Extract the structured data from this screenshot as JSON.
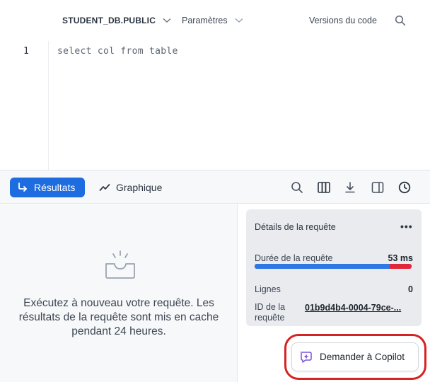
{
  "toolbar": {
    "database": "STUDENT_DB.PUBLIC",
    "params_label": "Paramètres",
    "versions_label": "Versions du code"
  },
  "editor": {
    "line_number": "1",
    "code": "select col from table"
  },
  "results_bar": {
    "results_label": "Résultats",
    "chart_label": "Graphique"
  },
  "empty_state": {
    "message": "Exécutez à nouveau votre requête. Les résultats de la requête sont mis en cache pendant 24 heures."
  },
  "details": {
    "title": "Détails de la requête",
    "more": "•••",
    "duration_label": "Durée de la requête",
    "duration_value": "53 ms",
    "duration_split": 0.86,
    "rows_label": "Lignes",
    "rows_value": "0",
    "id_label": "ID de la requête",
    "id_value": "01b9d4b4-0004-79ce-..."
  },
  "copilot": {
    "label": "Demander à Copilot"
  },
  "colors": {
    "accent": "#1d6ce0",
    "bar_blue": "#2e77e5",
    "bar_red": "#e0263a",
    "highlight_ring": "#d52222"
  }
}
